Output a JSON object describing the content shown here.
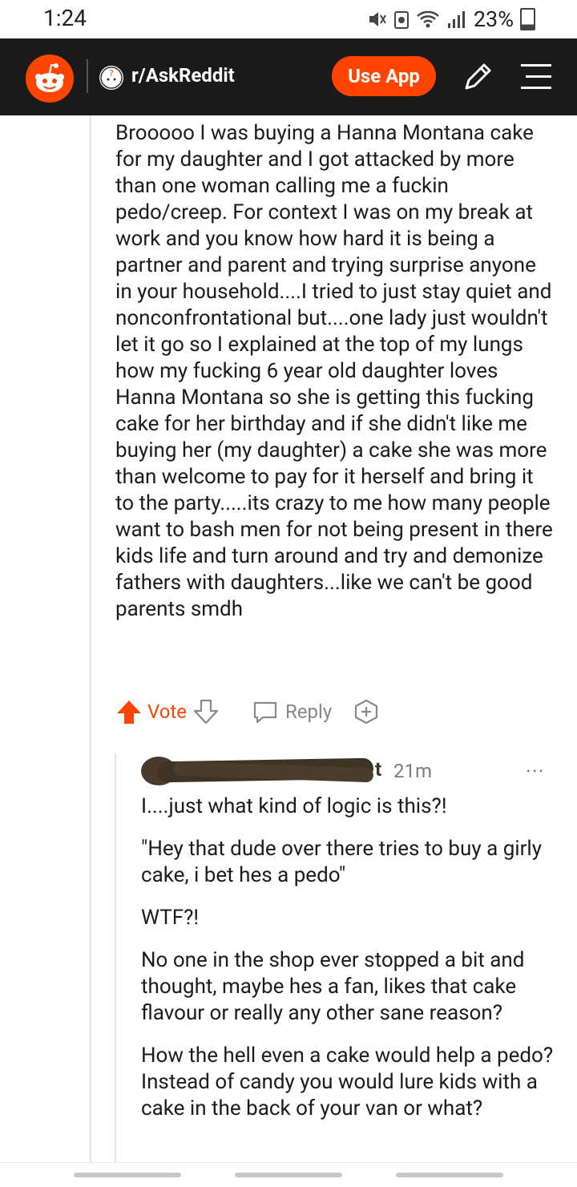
{
  "status_bar": {
    "time": "1:24",
    "battery": "23%"
  },
  "header": {
    "subreddit": "r/AskReddit",
    "use_app_label": "Use App"
  },
  "comment": {
    "body": "Brooooo I was buying a Hanna Montana cake for my daughter and I got attacked by more than one woman calling me a fuckin pedo/creep. For context I was on my break at work and you know how hard it is being a partner and parent and trying surprise anyone in your household....I tried to just stay quiet and nonconfrontational but....one lady just wouldn't let it go so I explained at the top of my lungs how my fucking 6 year old daughter loves Hanna Montana so she is getting this fucking cake for her birthday and if she didn't like me buying her (my daughter) a cake she was more than welcome to pay for it herself and bring it to the party.....its crazy to me how many people want to bash men for not being present in there kids life and turn around and try and demonize fathers with daughters...like we can't be good parents smdh",
    "actions": {
      "vote_label": "Vote",
      "reply_label": "Reply"
    }
  },
  "reply": {
    "username_tail": "t",
    "timestamp": "21m",
    "more": "...",
    "paragraphs": [
      "I....just what kind of logic is this?!",
      "\"Hey that dude over there tries to buy a girly cake, i bet hes a pedo\"",
      "WTF?!",
      "No one in the shop ever stopped a bit and thought, maybe hes a fan, likes that cake flavour or really any other sane reason?",
      "How the hell even a cake would help a pedo? Instead of candy you would lure kids with a cake in the back of your van or what?"
    ]
  },
  "colors": {
    "accent": "#ff4500",
    "header_bg": "#1a1a1b"
  },
  "icons": [
    "reddit-logo",
    "upvote-icon",
    "downvote-icon",
    "comment-icon",
    "award-icon",
    "pencil-icon",
    "menu-icon"
  ]
}
